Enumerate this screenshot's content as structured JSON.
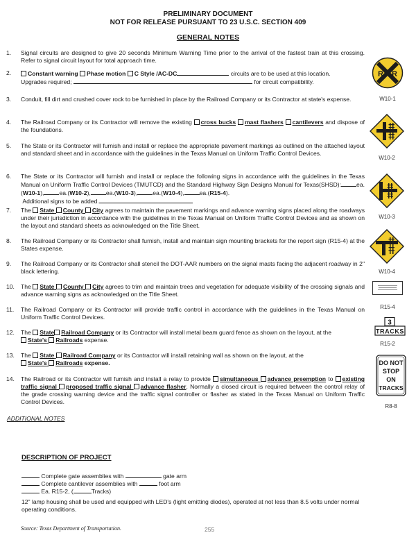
{
  "header": {
    "line1": "PRELIMINARY DOCUMENT",
    "line2": "NOT FOR RELEASE PURSUANT TO 23 U.S.C. SECTION 409",
    "section_title": "GENERAL NOTES"
  },
  "notes": {
    "n1": {
      "num": "1.",
      "text": "Signal circuits are designed to give 20 seconds Minimum Warning Time prior to the arrival of the fastest train at this crossing.  Refer to signal circuit layout for total approach time."
    },
    "n2": {
      "num": "2.",
      "opt1": "Constant warning",
      "opt2": "Phase motion",
      "opt3": "C Style /AC-DC",
      "after": "circuits are to be used at this location.",
      "upgrades": "Upgrades required;",
      "compat": "for circuit compatibility."
    },
    "n3": {
      "num": "3.",
      "text": "Conduit, fill dirt and crushed cover rock to be furnished in place by the Railroad Company or its Contractor at state's expense."
    },
    "n4": {
      "num": "4.",
      "pre": "The Railroad Company or its Contractor will remove the existing",
      "opt1": "cross bucks",
      "opt2": "mast flashers",
      "opt3": "cantilevers",
      "post": "and dispose of the foundations."
    },
    "n5": {
      "num": "5.",
      "text": "The State or its Contractor will furnish and install or replace the appropriate pavement markings as outlined on the attached layout and standard sheet and in accordance with the guidelines in the Texas Manual on Uniform Traffic Control Devices."
    },
    "n6": {
      "num": "6.",
      "text": "The State or its Contractor will furnish and install or replace the following signs in accordance with the guidelines in the Texas Manual on Uniform Traffic Control Devices (TMUTCD) and the Standard Highway Sign Designs Manual for Texas(SHSD):",
      "ea": "ea.",
      "codes": [
        "W10-1",
        "W10-2",
        "W10-3",
        "W10-4",
        "R15-4"
      ],
      "additional": "Additional signs to be added."
    },
    "n7": {
      "num": "7.",
      "pre": "The",
      "opt1": "State",
      "opt2": "County",
      "opt3": "City",
      "post": "agrees to maintain the pavement markings and advance warning signs placed along the roadways under their jurisdiction in accordance with the guidelines in the Texas Manual on Uniform Traffic Control Devices and as shown on the layout and standard sheets as acknowledged on the Title Sheet."
    },
    "n8": {
      "num": "8.",
      "text": "The Railroad Company or its Contractor shall furnish, install and maintain sign mounting brackets for the report sign (R15-4) at the States expense."
    },
    "n9": {
      "num": "9.",
      "text": "The Railroad Company or its Contractor shall stencil the DOT-AAR numbers on the signal masts facing the adjacent roadway in 2\" black lettering."
    },
    "n10": {
      "num": "10.",
      "pre": "The",
      "opt1": "State",
      "opt2": "County",
      "opt3": "City",
      "post": "agrees to trim and maintain trees and vegetation for adequate visibility of the crossing signals and advance warning signs as acknowledged on the Title Sheet."
    },
    "n11": {
      "num": "11.",
      "text": "The Railroad Company or its Contractor will provide traffic control in accordance with the guidelines in the Texas Manual on Uniform Traffic Control Devices."
    },
    "n12": {
      "num": "12.",
      "pre": "The",
      "opt1": "State",
      "opt2": "Railroad Company",
      "mid": "or its Contractor will install metal beam guard fence as shown on the layout, at the",
      "opt3": "State's",
      "opt4": "Railroads",
      "post": "expense."
    },
    "n13": {
      "num": "13.",
      "pre": "The",
      "opt1": "State",
      "opt2": "Railroad Company",
      "mid": "or its Contractor will install retaining wall as shown on the layout, at the",
      "opt3": "State's",
      "opt4": "Railroads",
      "post": "expense."
    },
    "n14": {
      "num": "14.",
      "pre": "The Railroad or its Contractor will furnish and install a relay to provide",
      "opt1": "simultaneous",
      "opt2": "advance preemption",
      "to": "to",
      "opt3": "existing traffic signal",
      "opt4": "proposed traffic signal",
      "opt5": "advance flasher",
      "post": ".  Normally a closed circuit is required between the control relay of the grade crossing warning device and the traffic signal controller or flasher as stated in the Texas Manual on Uniform Traffic Control Devices."
    }
  },
  "signs": [
    {
      "code": "W10-1",
      "glyph": "R R",
      "color": "#f2cc2e"
    },
    {
      "code": "W10-2",
      "color": "#f2cc2e"
    },
    {
      "code": "W10-3",
      "color": "#f2cc2e"
    },
    {
      "code": "W10-4",
      "color": "#f2cc2e"
    },
    {
      "code": "R15-4"
    },
    {
      "code": "R15-2",
      "number": "3",
      "word": "TRACKS"
    },
    {
      "code": "R8-8",
      "lines": [
        "DO NOT",
        "STOP",
        "ON",
        "TRACKS"
      ]
    }
  ],
  "additional_notes": "ADDITIONAL NOTES",
  "description": {
    "title": "DESCRIPTION OF PROJECT",
    "line1a": "Complete gate assemblies with",
    "line1b": "gate arm",
    "line2a": "Complete cantilever assemblies with",
    "line2b": "foot arm",
    "line3a": "Ea. R15-2, (",
    "line3b": "Tracks)",
    "paragraph": "12\" lamp housing shall be used and equipped with LED's (light emitting diodes), operated at not less than 8.5 volts under normal operating conditions."
  },
  "footer": {
    "source": "Source: Texas Department of Transportation.",
    "page_number": "255"
  }
}
